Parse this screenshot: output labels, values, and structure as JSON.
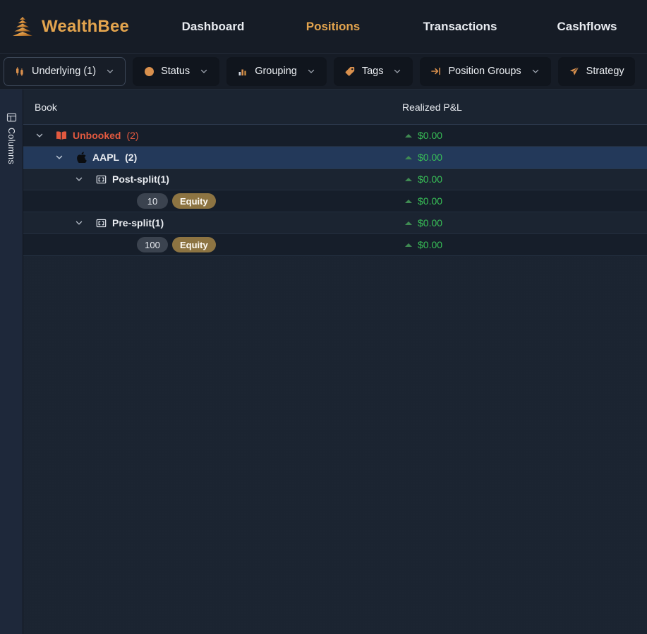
{
  "app": {
    "brand_name": "WealthBee",
    "logo_icon": "beehive-logo-icon"
  },
  "nav": {
    "items": [
      {
        "label": "Dashboard",
        "active": false
      },
      {
        "label": "Positions",
        "active": true
      },
      {
        "label": "Transactions",
        "active": false
      },
      {
        "label": "Cashflows",
        "active": false
      }
    ]
  },
  "filters": {
    "chips": [
      {
        "label": "Underlying (1)",
        "icon": "candlestick-icon",
        "active": true,
        "caret": true
      },
      {
        "label": "Status",
        "icon": "status-dot-icon",
        "active": false,
        "caret": true
      },
      {
        "label": "Grouping",
        "icon": "bar-chart-icon",
        "active": false,
        "caret": true
      },
      {
        "label": "Tags",
        "icon": "tag-icon",
        "active": false,
        "caret": true
      },
      {
        "label": "Position Groups",
        "icon": "arrow-to-line-icon",
        "active": false,
        "caret": true
      },
      {
        "label": "Strategy",
        "icon": "paper-plane-icon",
        "active": false,
        "caret": false
      }
    ]
  },
  "columns_rail": {
    "label": "Columns",
    "icon": "columns-table-icon"
  },
  "table": {
    "headers": {
      "book": "Book",
      "realized_pnl": "Realized P&L"
    },
    "rows": [
      {
        "kind": "group",
        "indent": 0,
        "twisty": "chevron-down-icon",
        "icon": "book-icon",
        "label": "Unbooked",
        "count": "(2)",
        "style": "unbooked",
        "selected": false,
        "pnl": "$0.00",
        "pnl_trend": "up"
      },
      {
        "kind": "group",
        "indent": 1,
        "twisty": "chevron-down-icon",
        "icon": "apple-icon",
        "label": "AAPL",
        "count": "(2)",
        "style": "normal",
        "selected": true,
        "pnl": "$0.00",
        "pnl_trend": "up"
      },
      {
        "kind": "group",
        "indent": 2,
        "twisty": "chevron-down-icon",
        "icon": "frame-icon",
        "label": "Post-split(1)",
        "count": "",
        "style": "normal",
        "selected": false,
        "pnl": "$0.00",
        "pnl_trend": "up"
      },
      {
        "kind": "leaf",
        "indent": 3,
        "quantity": "10",
        "instrument_type": "Equity",
        "selected": false,
        "pnl": "$0.00",
        "pnl_trend": "up"
      },
      {
        "kind": "group",
        "indent": 2,
        "twisty": "chevron-down-icon",
        "icon": "frame-icon",
        "label": "Pre-split(1)",
        "count": "",
        "style": "normal",
        "selected": false,
        "pnl": "$0.00",
        "pnl_trend": "up"
      },
      {
        "kind": "leaf",
        "indent": 3,
        "quantity": "100",
        "instrument_type": "Equity",
        "selected": false,
        "pnl": "$0.00",
        "pnl_trend": "up"
      }
    ]
  },
  "colors": {
    "brand_orange": "#e3a44e",
    "active_tab": "#e3a44e",
    "unbooked_red": "#e2593f",
    "positive_green": "#38c057",
    "selected_row": "#23395a",
    "page_bg": "#161c26",
    "grid_bg": "#1b2431",
    "equity_badge": "#8d7442"
  }
}
